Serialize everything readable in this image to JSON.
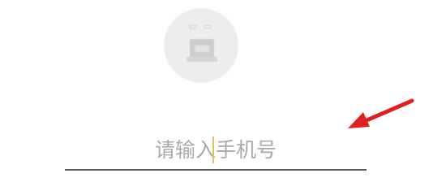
{
  "login": {
    "phone_placeholder": "请输入手机号",
    "phone_value": ""
  },
  "logo": {
    "icon": "app-logo-icon"
  },
  "annotation": {
    "icon": "red-arrow-icon",
    "color": "#e02020"
  }
}
